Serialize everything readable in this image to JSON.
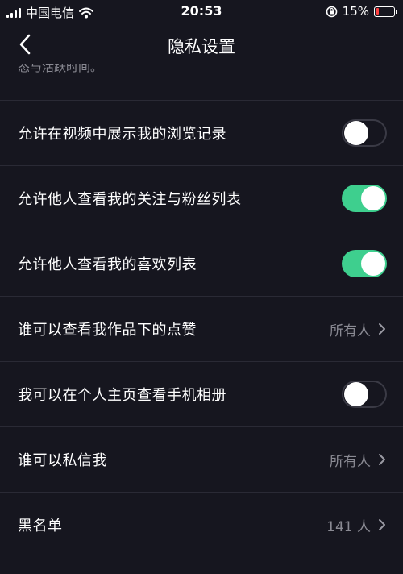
{
  "status_bar": {
    "carrier": "中国电信",
    "time": "20:53",
    "battery_text": "15%",
    "battery_level": 0.15,
    "battery_color": "#ff4040"
  },
  "nav": {
    "title": "隐私设置",
    "back_icon": "chevron-left-icon"
  },
  "partial_text": "态与活跃时间。",
  "colors": {
    "toggle_on": "#3ecf8e",
    "background": "#16161f"
  },
  "rows": [
    {
      "label": "允许在视频中展示我的浏览记录",
      "type": "toggle",
      "on": false
    },
    {
      "label": "允许他人查看我的关注与粉丝列表",
      "type": "toggle",
      "on": true
    },
    {
      "label": "允许他人查看我的喜欢列表",
      "type": "toggle",
      "on": true
    },
    {
      "label": "谁可以查看我作品下的点赞",
      "type": "select",
      "value": "所有人"
    },
    {
      "label": "我可以在个人主页查看手机相册",
      "type": "toggle",
      "on": false
    },
    {
      "label": "谁可以私信我",
      "type": "select",
      "value": "所有人"
    },
    {
      "label": "黑名单",
      "type": "select",
      "value": "141 人"
    }
  ]
}
